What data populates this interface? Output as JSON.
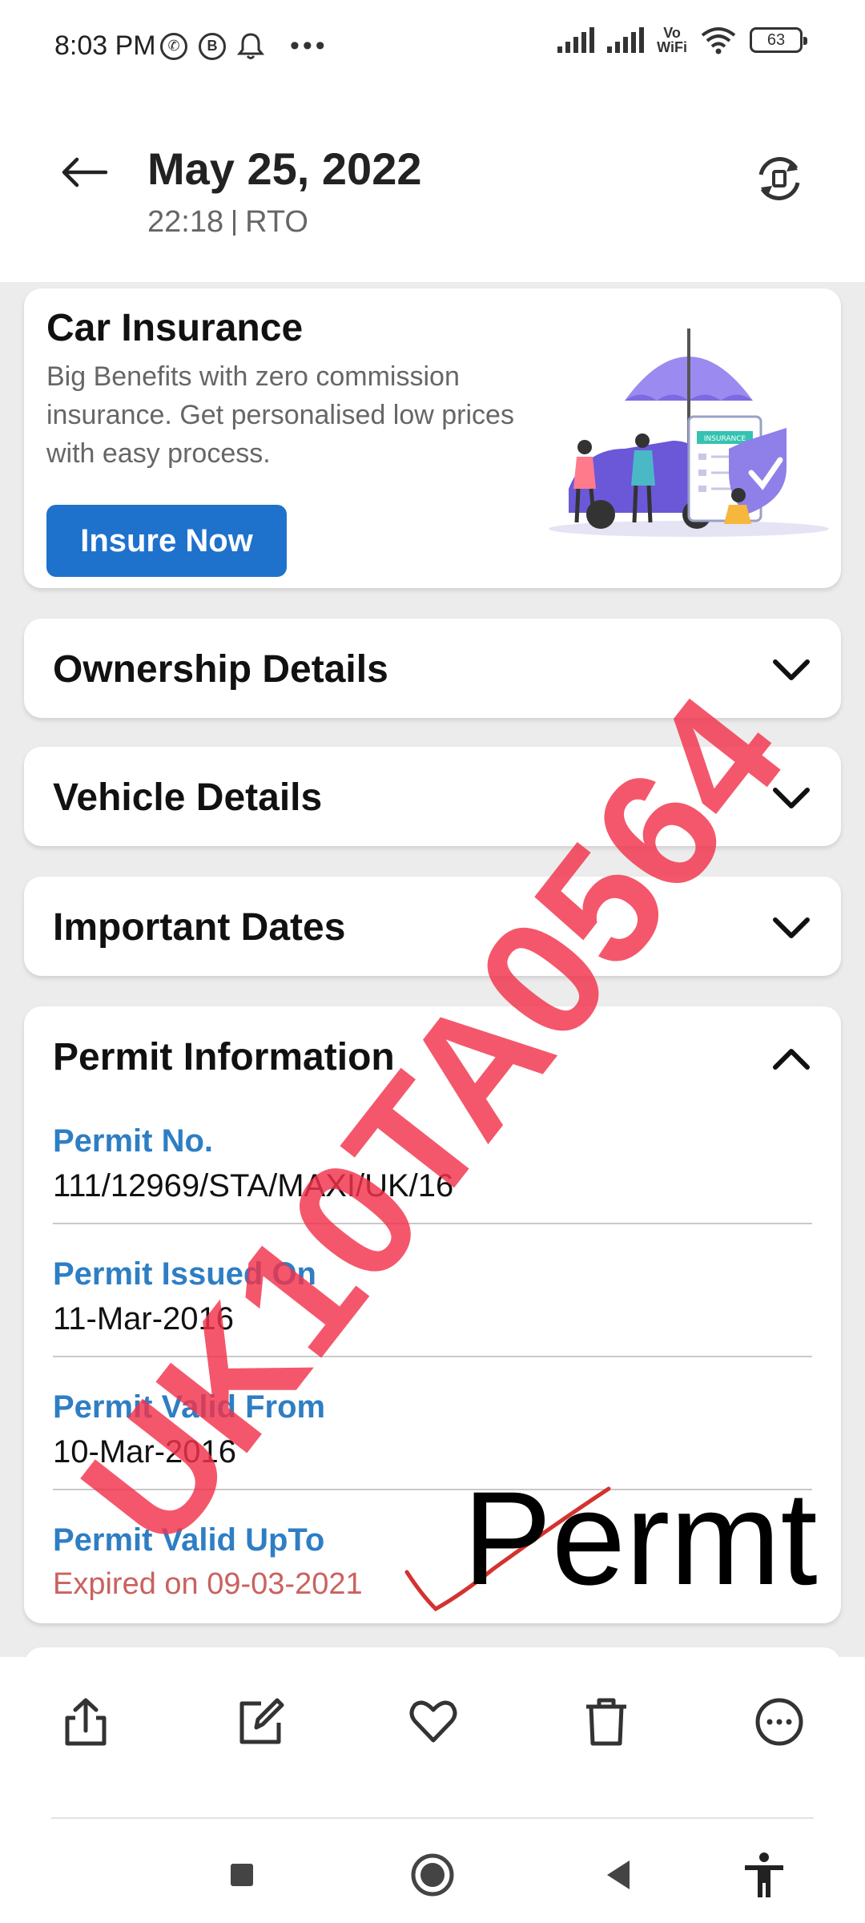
{
  "status_bar": {
    "time": "8:03 PM",
    "left_icons": [
      "whatsapp-icon",
      "whatsapp-business-icon",
      "notification-bell-icon",
      "more-notifications-icon"
    ],
    "vowifi_line1": "Vo",
    "vowifi_line2": "WiFi",
    "battery": "63"
  },
  "header": {
    "title": "May 25, 2022",
    "time": "22:18",
    "source": "RTO",
    "back_icon": "arrow-left-icon",
    "action_icon": "rotate-icon"
  },
  "insurance_card": {
    "title": "Car Insurance",
    "description": "Big Benefits with zero commission insurance. Get personalised low prices with easy process.",
    "button_label": "Insure Now",
    "button_color": "#1e72cc",
    "illustration_label": "INSURANCE"
  },
  "accordions": [
    {
      "title": "Ownership Details",
      "expanded": false
    },
    {
      "title": "Vehicle Details",
      "expanded": false
    },
    {
      "title": "Important Dates",
      "expanded": false
    }
  ],
  "permit": {
    "title": "Permit Information",
    "expanded": true,
    "fields": [
      {
        "label": "Permit No.",
        "value": "111/12969/STA/MAXI/UK/16"
      },
      {
        "label": "Permit Issued On",
        "value": "11-Mar-2016"
      },
      {
        "label": "Permit Valid From",
        "value": "10-Mar-2016"
      }
    ],
    "valid_upto_label": "Permit Valid UpTo",
    "valid_upto_value": "Expired on 09-03-2021",
    "label_color": "#2e7ec4",
    "expired_color": "#c9625f"
  },
  "overlay": {
    "watermark": "UK10TA0564",
    "watermark_color": "#f2324b",
    "handwritten": "Permt"
  },
  "bottom_actions": [
    "share-icon",
    "edit-icon",
    "heart-icon",
    "delete-icon",
    "more-options-icon"
  ],
  "nav_bar": [
    "recents-square-icon",
    "home-circle-icon",
    "back-triangle-icon",
    "accessibility-icon"
  ]
}
